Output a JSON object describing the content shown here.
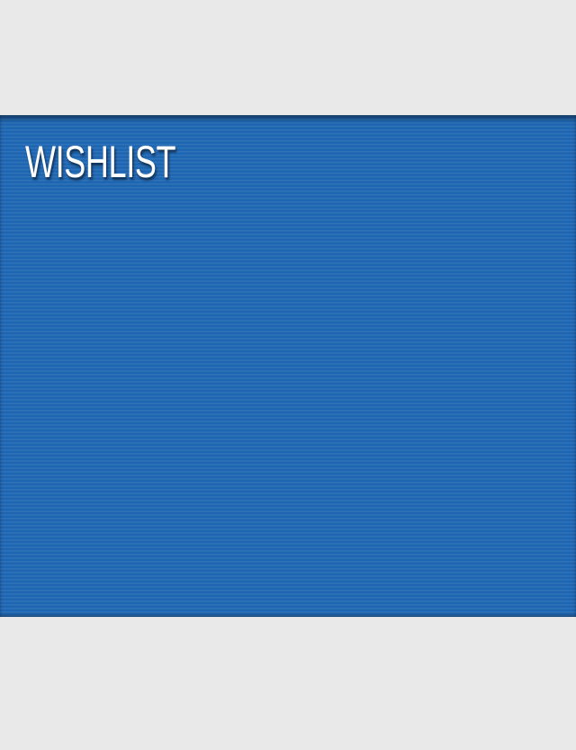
{
  "panel": {
    "title": "WISHLIST",
    "background_color": "#1f68b5",
    "page_background_color": "#e9e9e9"
  }
}
